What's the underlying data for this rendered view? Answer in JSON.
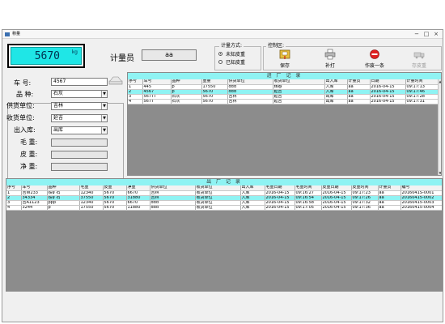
{
  "window": {
    "title": "称量"
  },
  "weight": {
    "value": "5670",
    "unit": "kg"
  },
  "operator": {
    "label": "计量员",
    "value": "aa"
  },
  "measure_mode": {
    "title": "计量方式:",
    "options": [
      {
        "label": "未知皮重",
        "selected": true
      },
      {
        "label": "已知皮重",
        "selected": false
      }
    ]
  },
  "control": {
    "title": "控制区:",
    "buttons": [
      {
        "label": "保存",
        "icon": "save-icon"
      },
      {
        "label": "补打",
        "icon": "printer-icon"
      },
      {
        "label": "作废一条",
        "icon": "delete-icon"
      },
      {
        "label": "存皮重",
        "icon": "truck-icon"
      }
    ]
  },
  "form": {
    "plate": {
      "label": "车  号:",
      "value": "4567"
    },
    "variety": {
      "label": "品  种:",
      "value": "石灰"
    },
    "supplier": {
      "label": "供货单位:",
      "value": "吉林"
    },
    "receiver": {
      "label": "收货单位:",
      "value": "延吉"
    },
    "inout": {
      "label": "出入库:",
      "value": "出库"
    },
    "gross": {
      "label": "毛  重:",
      "value": ""
    },
    "tare": {
      "label": "皮  重:",
      "value": ""
    },
    "net": {
      "label": "净  重:",
      "value": ""
    }
  },
  "in_records": {
    "title": "进 厂 记 录",
    "columns": [
      "序号",
      "车号",
      "品种",
      "重量",
      "供货单位",
      "收货单位",
      "出入库",
      "计量员",
      "日期",
      "计量时间"
    ],
    "rows": [
      [
        "1",
        "445",
        "p",
        "17550",
        "ddd",
        "辉春",
        "入库",
        "aa",
        "2016-04-15",
        "09:17:13"
      ],
      [
        "2",
        "4567",
        "p",
        "5670",
        "ddd",
        "延吉",
        "入库",
        "aa",
        "2016-04-15",
        "09:17:46"
      ],
      [
        "3",
        "567TT",
        "石灰",
        "5670",
        "吉林",
        "延吉",
        "出库",
        "aa",
        "2016-04-15",
        "09:17:28"
      ],
      [
        "4",
        "567T",
        "石灰",
        "5670",
        "吉林",
        "延吉",
        "出库",
        "aa",
        "2016-04-15",
        "09:17:31"
      ]
    ],
    "selected_row": 1
  },
  "out_records": {
    "title": "出 厂 记 录",
    "columns": [
      "序号",
      "车号",
      "品种",
      "毛重",
      "皮重",
      "净重",
      "供货单位",
      "收货单位",
      "出入库",
      "毛重日期",
      "毛重时间",
      "皮重日期",
      "皮重时间",
      "计量员",
      "编号"
    ],
    "rows": [
      [
        "1",
        "吉W233",
        "铁矿石",
        "12340",
        "5670",
        "6670",
        "吉林",
        "收货单位",
        "入库",
        "2016-04-15",
        "09:16:27",
        "2016-04-15",
        "09:17:23",
        "aa",
        "2016041S-0001"
      ],
      [
        "2",
        "34334",
        "铁矿石",
        "37550",
        "5670",
        "31880",
        "吉林",
        "收货单位",
        "入库",
        "2016-04-15",
        "09:16:54",
        "2016-04-15",
        "09:17:26",
        "aa",
        "20160415-0002"
      ],
      [
        "3",
        "吉A1123",
        "ppp",
        "12340",
        "5670",
        "6670",
        "ddd",
        "收货单位",
        "入库",
        "2016-04-15",
        "09:16:58",
        "2016-04-15",
        "09:17:32",
        "aa",
        "20160415-0003"
      ],
      [
        "4",
        "3244",
        "p",
        "17550",
        "5670",
        "11880",
        "ddd",
        "收货单位",
        "入库",
        "2016-04-15",
        "09:17:05",
        "2016-04-15",
        "09:17:36",
        "aa",
        "20160415-0004"
      ]
    ],
    "selected_row": 1
  }
}
